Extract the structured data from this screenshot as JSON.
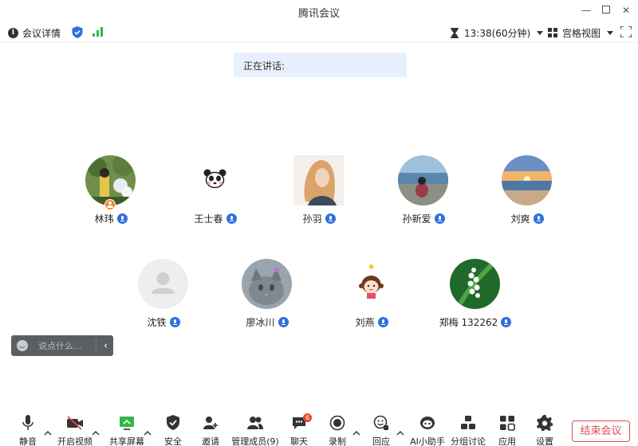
{
  "window": {
    "title": "腾讯会议"
  },
  "infobar": {
    "meeting_details": "会议详情",
    "timer": "13:38(60分钟)",
    "view_mode": "宫格视图"
  },
  "speaking": {
    "label": "正在讲话:"
  },
  "participants": [
    {
      "name": "林玮",
      "avatar": "photo-woman-flowers",
      "host": true
    },
    {
      "name": "王士春",
      "avatar": "panda-emoji"
    },
    {
      "name": "孙羽",
      "avatar": "photo-woman-portrait"
    },
    {
      "name": "孙新爱",
      "avatar": "photo-seaside"
    },
    {
      "name": "刘爽",
      "avatar": "photo-sunset-beach"
    },
    {
      "name": "沈铁",
      "avatar": "default-user"
    },
    {
      "name": "廖冰川",
      "avatar": "photo-cat"
    },
    {
      "name": "刘燕",
      "avatar": "cartoon-girl"
    },
    {
      "name": "郑梅 132262",
      "avatar": "photo-lily-of-the-valley"
    }
  ],
  "chat": {
    "placeholder": "说点什么..."
  },
  "toolbar": {
    "mute": "静音",
    "video": "开启视频",
    "share": "共享屏幕",
    "security": "安全",
    "invite": "邀请",
    "members": "管理成员(9)",
    "chat": "聊天",
    "chat_badge": "6",
    "record": "录制",
    "reaction": "回应",
    "ai_assistant": "AI小助手",
    "breakout": "分组讨论",
    "apps": "应用",
    "settings": "设置",
    "end_meeting": "结束会议"
  },
  "colors": {
    "accent": "#2f6fe0",
    "end_button": "#e24b4b",
    "signal": "#2db84d",
    "speaking_bg": "#e8f0fd"
  }
}
